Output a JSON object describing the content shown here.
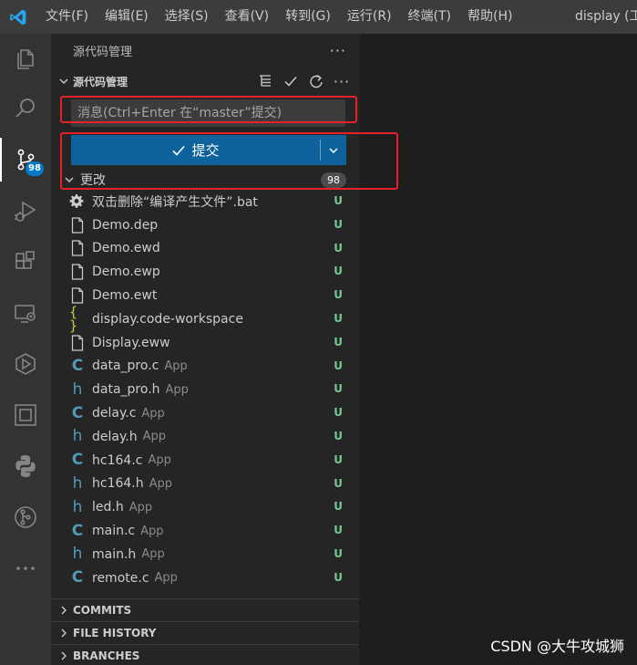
{
  "titlebar": {
    "menu": [
      "文件(F)",
      "编辑(E)",
      "选择(S)",
      "查看(V)",
      "转到(G)",
      "运行(R)",
      "终端(T)",
      "帮助(H)"
    ],
    "window_title": "display (工"
  },
  "activitybar": {
    "items": [
      {
        "icon": "explorer-icon"
      },
      {
        "icon": "search-icon"
      },
      {
        "icon": "source-control-icon",
        "badge": "98"
      },
      {
        "icon": "run-debug-icon"
      },
      {
        "icon": "extensions-icon"
      },
      {
        "icon": "remote-explorer-icon"
      },
      {
        "icon": "platformio-icon"
      },
      {
        "icon": "chip-icon"
      },
      {
        "icon": "python-icon"
      },
      {
        "icon": "git-graph-icon"
      },
      {
        "icon": "more-icon"
      }
    ]
  },
  "sidebar": {
    "header_title": "源代码管理",
    "section_title": "源代码管理",
    "message_placeholder": "消息(Ctrl+Enter 在“master”提交)",
    "commit_label": "提交",
    "changes_label": "更改",
    "changes_count": "98",
    "files": [
      {
        "name": "双击删除“编译产生文件”.bat",
        "desc": "",
        "status": "U",
        "type": "gear"
      },
      {
        "name": "Demo.dep",
        "desc": "",
        "status": "U",
        "type": "file"
      },
      {
        "name": "Demo.ewd",
        "desc": "",
        "status": "U",
        "type": "file"
      },
      {
        "name": "Demo.ewp",
        "desc": "",
        "status": "U",
        "type": "file"
      },
      {
        "name": "Demo.ewt",
        "desc": "",
        "status": "U",
        "type": "file"
      },
      {
        "name": "display.code-workspace",
        "desc": "",
        "status": "U",
        "type": "brace"
      },
      {
        "name": "Display.eww",
        "desc": "",
        "status": "U",
        "type": "file"
      },
      {
        "name": "data_pro.c",
        "desc": "App",
        "status": "U",
        "type": "c"
      },
      {
        "name": "data_pro.h",
        "desc": "App",
        "status": "U",
        "type": "h"
      },
      {
        "name": "delay.c",
        "desc": "App",
        "status": "U",
        "type": "c"
      },
      {
        "name": "delay.h",
        "desc": "App",
        "status": "U",
        "type": "h"
      },
      {
        "name": "hc164.c",
        "desc": "App",
        "status": "U",
        "type": "c"
      },
      {
        "name": "hc164.h",
        "desc": "App",
        "status": "U",
        "type": "h"
      },
      {
        "name": "led.h",
        "desc": "App",
        "status": "U",
        "type": "h"
      },
      {
        "name": "main.c",
        "desc": "App",
        "status": "U",
        "type": "c"
      },
      {
        "name": "main.h",
        "desc": "App",
        "status": "U",
        "type": "h"
      },
      {
        "name": "remote.c",
        "desc": "App",
        "status": "U",
        "type": "c"
      }
    ],
    "collapsed_sections": [
      "COMMITS",
      "FILE HISTORY",
      "BRANCHES"
    ]
  },
  "watermark": "CSDN @大牛攻城狮",
  "colors": {
    "accent": "#0e639c",
    "highlight": "#e8202a",
    "untracked": "#73c991",
    "badge": "#007acc"
  }
}
